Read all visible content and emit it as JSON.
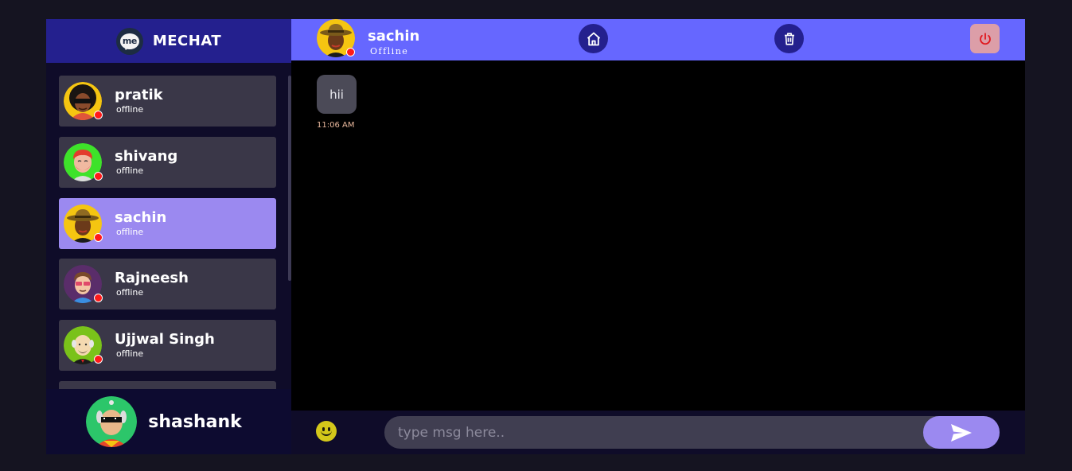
{
  "brand": {
    "title": "MECHAT",
    "logo_text": "me"
  },
  "contacts": [
    {
      "name": "pratik",
      "status": "offline",
      "avatar": "afro-sunglasses-avatar"
    },
    {
      "name": "shivang",
      "status": "offline",
      "avatar": "red-hair-avatar"
    },
    {
      "name": "sachin",
      "status": "offline",
      "avatar": "hat-avatar",
      "active": true
    },
    {
      "name": "Rajneesh",
      "status": "offline",
      "avatar": "glasses-avatar"
    },
    {
      "name": "Ujjwal Singh",
      "status": "offline",
      "avatar": "bald-avatar"
    }
  ],
  "me": {
    "name": "shashank",
    "avatar": "cool-glasses-avatar"
  },
  "chat": {
    "name": "sachin",
    "status": "Offline",
    "buttons": {
      "home": "home-icon",
      "delete": "trash-icon",
      "logout": "power-icon"
    },
    "messages": [
      {
        "text": "hii",
        "time": "11:06 AM"
      }
    ]
  },
  "composer": {
    "placeholder": "type msg here..",
    "value": ""
  },
  "colors": {
    "header": "#6667ff",
    "brand_bar": "#24208e",
    "active_contact": "#9b89f0",
    "contact_bg": "#3a3748",
    "status_offline": "#ff1a1a"
  }
}
